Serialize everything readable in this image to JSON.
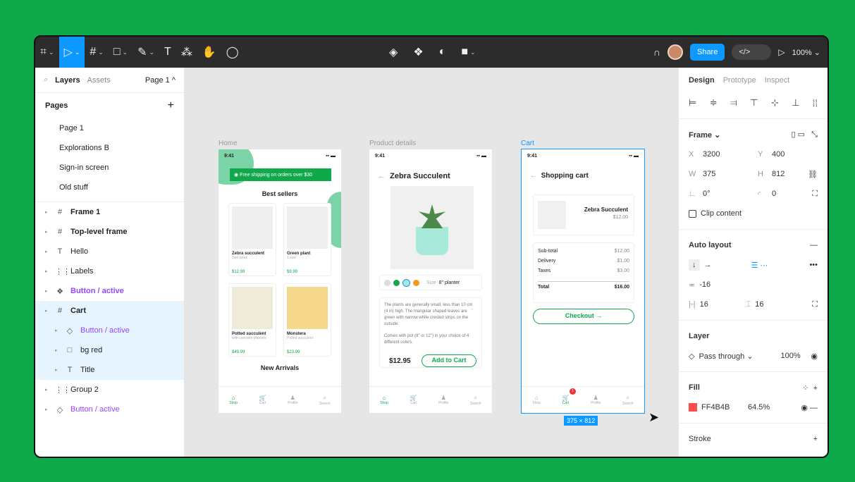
{
  "toolbar": {
    "zoom": "100%",
    "share": "Share",
    "code": "</>"
  },
  "left": {
    "tab_layers": "Layers",
    "tab_assets": "Assets",
    "page_picker": "Page 1 ^",
    "pages_title": "Pages",
    "add": "+",
    "pages": [
      "Page 1",
      "Explorations B",
      "Sign-in screen",
      "Old stuff"
    ],
    "layers": [
      {
        "label": "Frame 1",
        "icon": "#",
        "bold": true
      },
      {
        "label": "Top-level frame",
        "icon": "#",
        "bold": true
      },
      {
        "label": "Hello",
        "icon": "T"
      },
      {
        "label": "Labels",
        "icon": "⋮⋮"
      },
      {
        "label": "Button / active",
        "icon": "❖",
        "purple": true,
        "bold": true
      },
      {
        "label": "Cart",
        "icon": "#",
        "bold": true,
        "sel": true
      },
      {
        "label": "Button / active",
        "icon": "◇",
        "purple": true,
        "child": true,
        "sel": true
      },
      {
        "label": "bg red",
        "icon": "□",
        "child": true,
        "sel": true
      },
      {
        "label": "Title",
        "icon": "T",
        "child": true,
        "sel": true
      },
      {
        "label": "Group 2",
        "icon": "⋮⋮"
      },
      {
        "label": "Button / active",
        "icon": "◇",
        "purple": true
      }
    ]
  },
  "canvas": {
    "labels": {
      "home": "Home",
      "product": "Product details",
      "cart": "Cart"
    },
    "dims": "375 × 812",
    "time": "9:41",
    "home": {
      "banner": "Free shipping on orders over $30",
      "best": "Best sellers",
      "new": "New Arrivals",
      "products": [
        {
          "name": "Zebra succulent",
          "sub": "Two sizes",
          "price": "$12.99"
        },
        {
          "name": "Green plant",
          "sub": "1 size",
          "price": "$9.99"
        },
        {
          "name": "Potted succulent",
          "sub": "with concrete planters",
          "price": "$49.99"
        },
        {
          "name": "Monstera",
          "sub": "Potted succulent",
          "price": "$23.99"
        }
      ]
    },
    "product": {
      "title": "Zebra Succulent",
      "size_label": "Size",
      "size": "8\" planter",
      "desc1": "The plants are generally small, less than 10 cm (4 in) high. The triangular shaped leaves are green with narrow white crested strips on the outside.",
      "desc2": "Comes with pot (8\" or 12\") in your choice of 4 different colors.",
      "price": "$12.95",
      "cta": "Add to Cart"
    },
    "cart": {
      "title": "Shopping cart",
      "item": "Zebra Succulent",
      "item_price": "$12.00",
      "lines": [
        [
          "Sub-total",
          "$12.00"
        ],
        [
          "Delivery",
          "$1.00"
        ],
        [
          "Taxes",
          "$3.00"
        ]
      ],
      "total_label": "Total",
      "total": "$16.00",
      "checkout": "Checkout →",
      "badge": "1"
    },
    "nav": [
      "Shop",
      "Cart",
      "Profile",
      "Search"
    ]
  },
  "right": {
    "tabs": [
      "Design",
      "Prototype",
      "Inspect"
    ],
    "frame": "Frame ⌄",
    "x": "3200",
    "y": "400",
    "w": "375",
    "h": "812",
    "rot": "0°",
    "radius": "0",
    "clip": "Clip content",
    "auto": "Auto layout",
    "spacing": "-16",
    "pad_h": "16",
    "pad_v": "16",
    "layer": "Layer",
    "blend": "Pass through ⌄",
    "opacity": "100%",
    "fill": "Fill",
    "fill_hex": "FF4B4B",
    "fill_op": "64.5%",
    "fill_color": "#ff4b4b",
    "stroke": "Stroke"
  },
  "colors": {
    "accent": "#0d99ff",
    "green": "#0fa84a",
    "purple": "#9747ff"
  }
}
